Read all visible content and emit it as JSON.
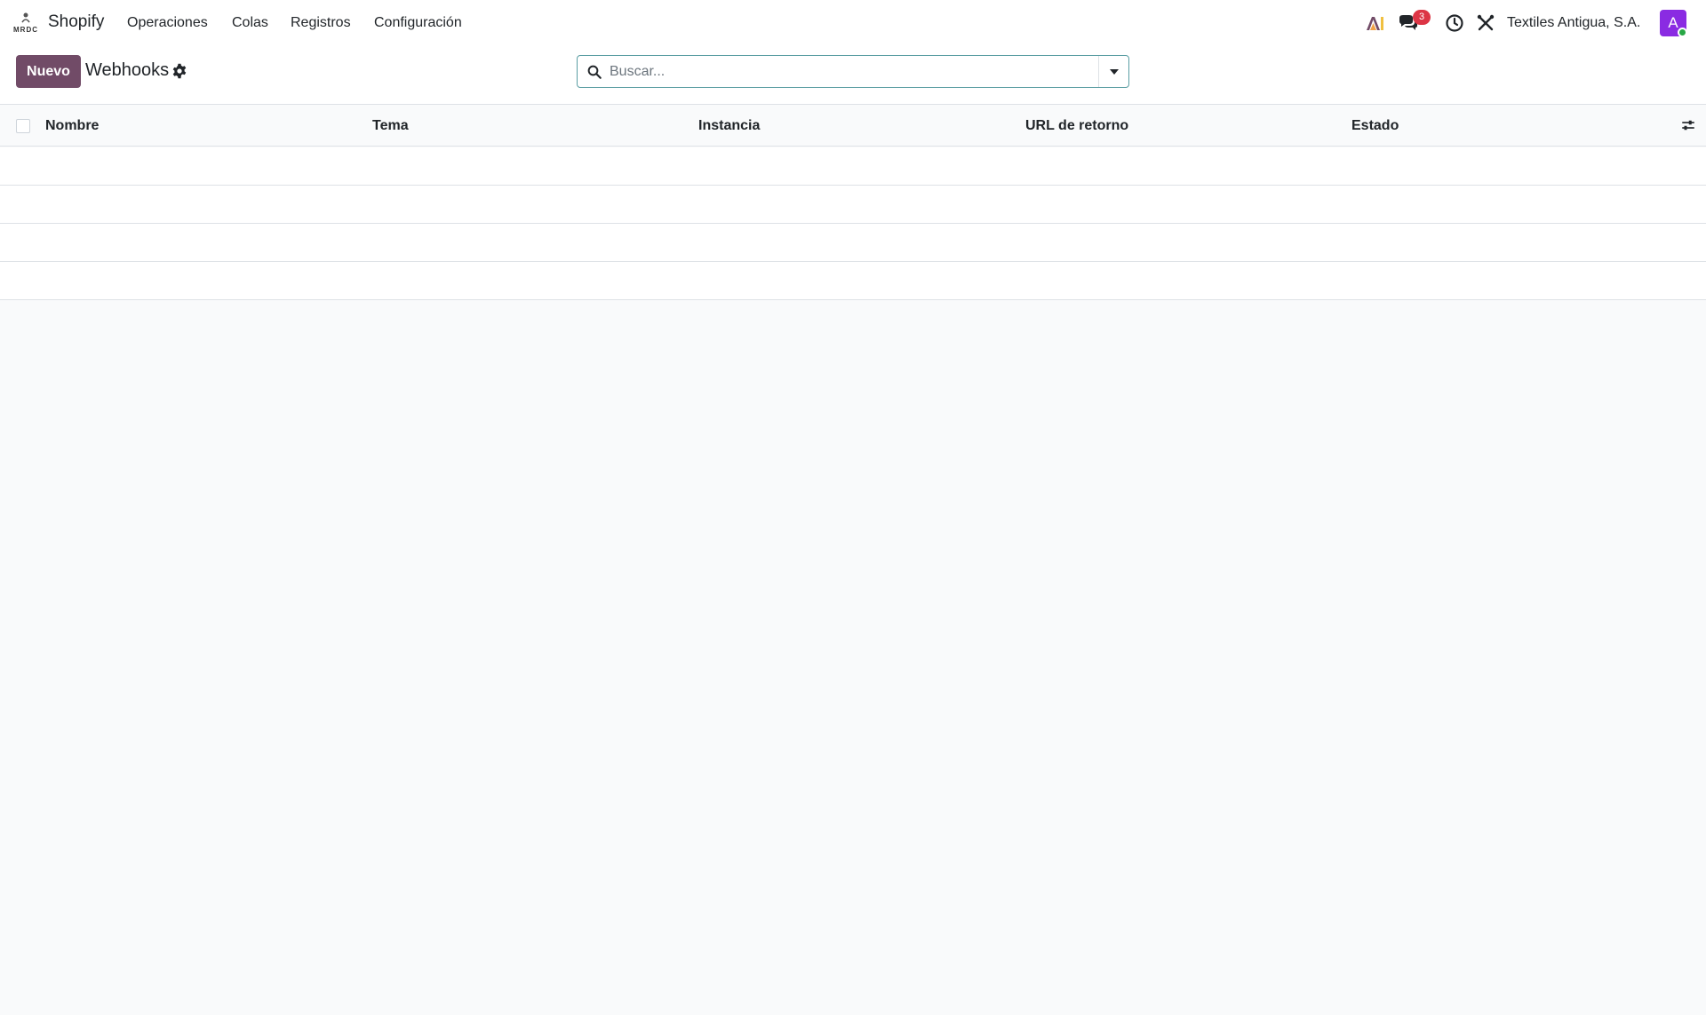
{
  "app": {
    "name": "Shopify",
    "logo_icon": "shopify-logo-icon"
  },
  "menu": {
    "items": [
      {
        "label": "Operaciones"
      },
      {
        "label": "Colas"
      },
      {
        "label": "Registros"
      },
      {
        "label": "Configuración"
      }
    ]
  },
  "systray": {
    "ai_icon": "ai-assistant-icon",
    "messages_icon": "chat-icon",
    "messages_count": "3",
    "activity_icon": "clock-icon",
    "tools_icon": "tools-icon",
    "company": "Textiles Antigua, S.A.",
    "avatar_letter": "A",
    "avatar_color": "#8a2be2",
    "status_color": "#28a745"
  },
  "control_panel": {
    "new_label": "Nuevo",
    "title": "Webhooks",
    "search_placeholder": "Buscar..."
  },
  "list": {
    "columns": [
      {
        "label": "Nombre"
      },
      {
        "label": "Tema"
      },
      {
        "label": "Instancia"
      },
      {
        "label": "URL de retorno"
      },
      {
        "label": "Estado"
      }
    ],
    "rows": []
  },
  "theme": {
    "primary": "#714b67",
    "search_border": "#5b9ea3",
    "badge": "#dc3545"
  }
}
